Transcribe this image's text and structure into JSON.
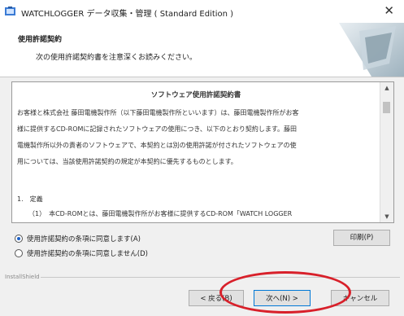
{
  "window": {
    "title": "WATCHLOGGER データ収集・管理 ( Standard Edition )",
    "close_glyph": "✕"
  },
  "banner": {
    "title": "使用許諾契約",
    "subtitle": "次の使用許諾契約書を注意深くお読みください。"
  },
  "license": {
    "heading": "ソフトウェア使用許諾契約書",
    "paragraph1": [
      "お客様と株式会社 藤田電機製作所（以下藤田電機製作所といいます）は、藤田電機製作所がお客",
      "様に提供するCD-ROMに記録されたソフトウェアの使用につき、以下のとおり契約します。藤田",
      "電機製作所以外の責者のソフトウェアで、本契約とは別の使用許諾が付されたソフトウェアの使",
      "用については、当該使用許諾契約の規定が本契約に優先するものとします。"
    ],
    "section_title": "1.　定義",
    "section_line": "（1）　本CD-ROMとは、藤田電機製作所がお客様に提供するCD-ROM「WATCH LOGGER"
  },
  "options": {
    "accept_label": "使用許諾契約の条項に同意します(A)",
    "decline_label": "使用許諾契約の条項に同意しません(D)",
    "selected": "accept"
  },
  "buttons": {
    "print": "印刷(P)",
    "back": "< 戻る(B)",
    "next": "次へ(N) >",
    "cancel": "キャンセル"
  },
  "footer": {
    "brand": "InstallShield"
  },
  "colors": {
    "annotation_ring": "#d8202a",
    "radio_dot": "#1a60c8"
  }
}
